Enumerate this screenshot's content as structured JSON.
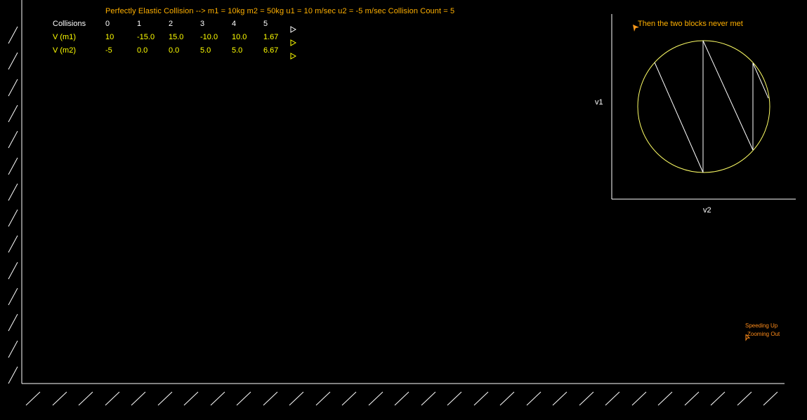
{
  "title": "Perfectly Elastic Collision --> m1 = 10kg  m2 = 50kg  u1 = 10 m/sec  u2 = -5 m/sec   Collision Count = 5",
  "table": {
    "header_label": "Collisions",
    "collision_numbers": [
      "0",
      "1",
      "2",
      "3",
      "4",
      "5"
    ],
    "rows": [
      {
        "label": "V (m1)",
        "values": [
          "10",
          "-15.0",
          "15.0",
          "-10.0",
          "10.0",
          "1.67"
        ]
      },
      {
        "label": "V (m2)",
        "values": [
          "-5",
          "0.0",
          "0.0",
          "5.0",
          "5.0",
          "6.67"
        ]
      }
    ]
  },
  "phase_plot": {
    "message": "Then the two blocks never met",
    "ylabel": "v1",
    "xlabel": "v2"
  },
  "controls": {
    "speed_label": "Speeding Up",
    "zoom_label": "Zooming Out"
  },
  "colors": {
    "background": "#000000",
    "title": "#ffb000",
    "table_values": "#ffff00",
    "circle": "#ffff66",
    "lines": "#ffffff"
  },
  "icons": [
    "play-arrow-icon",
    "pointer-arrow-icon",
    "hatch-wall"
  ]
}
